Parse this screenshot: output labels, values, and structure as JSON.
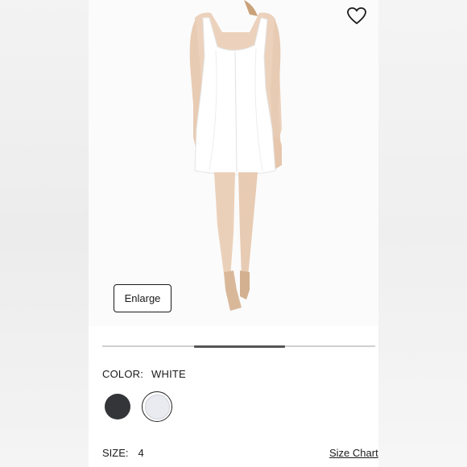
{
  "image": {
    "alt_icon": "product-photo-dress-back-view",
    "dress_color": "#ffffff"
  },
  "wishlist": {
    "icon": "heart-outline-icon"
  },
  "enlarge": {
    "label": "Enlarge"
  },
  "carousel": {
    "position_start": 0.335,
    "position_end": 0.67
  },
  "color": {
    "label": "COLOR:",
    "value": "WHITE",
    "swatches": [
      {
        "name": "black",
        "hex": "#333538",
        "selected": false
      },
      {
        "name": "white",
        "hex": "#e9ebf0",
        "selected": true
      }
    ]
  },
  "size": {
    "label": "SIZE:",
    "value": "4",
    "chart_link": "Size Chart"
  }
}
